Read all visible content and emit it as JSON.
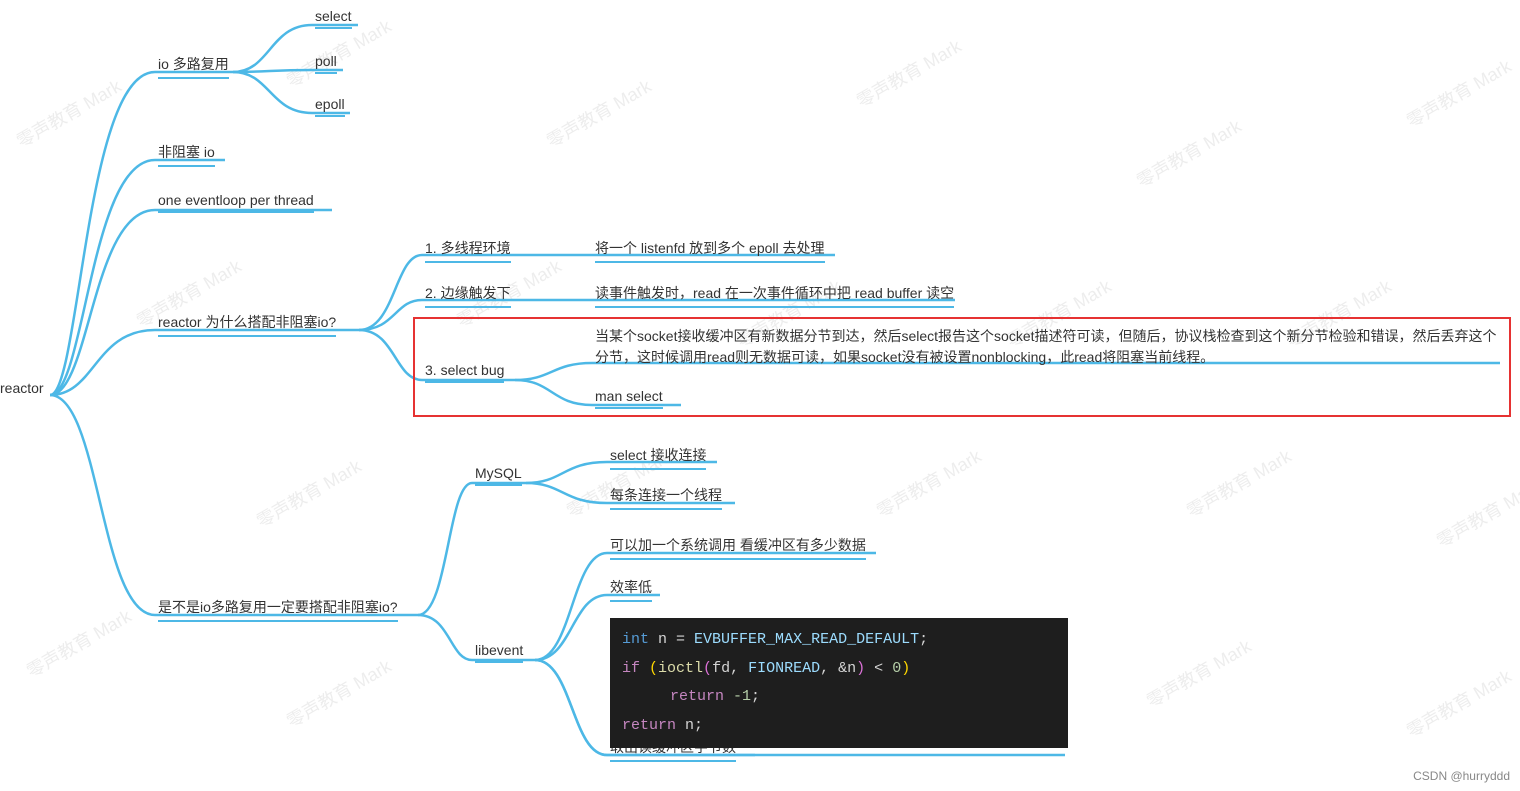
{
  "root": {
    "label": "reactor"
  },
  "branch1": {
    "label": "io 多路复用",
    "children": {
      "c1": "select",
      "c2": "poll",
      "c3": "epoll"
    }
  },
  "branch2": {
    "label": "非阻塞 io"
  },
  "branch3": {
    "label": "one eventloop per thread"
  },
  "branch4": {
    "label": "reactor 为什么搭配非阻塞io?",
    "children": {
      "c1": {
        "label": "1. 多线程环境",
        "leaf": "将一个 listenfd 放到多个 epoll 去处理"
      },
      "c2": {
        "label": "2. 边缘触发下",
        "leaf": "读事件触发时，read 在一次事件循环中把 read buffer 读空"
      },
      "c3": {
        "label": "3. select bug",
        "leaf1": "当某个socket接收缓冲区有新数据分节到达，然后select报告这个socket描述符可读，但随后，协议栈检查到这个新分节检验和错误，然后丢弃这个分节，这时候调用read则无数据可读，如果socket没有被设置nonblocking，此read将阻塞当前线程。",
        "leaf2": "man select"
      }
    }
  },
  "branch5": {
    "label": "是不是io多路复用一定要搭配非阻塞io?",
    "children": {
      "c1": {
        "label": "MySQL",
        "leaf1": "select 接收连接",
        "leaf2": "每条连接一个线程"
      },
      "c2": {
        "label": "libevent",
        "leaf1": "可以加一个系统调用  看缓冲区有多少数据",
        "leaf2": "效率低",
        "leaf3": "取出读缓冲区字节数"
      }
    }
  },
  "code": {
    "line1_a": "int",
    "line1_b": " n ",
    "line1_c": "=",
    "line1_d": " EVBUFFER_MAX_READ_DEFAULT",
    "line1_e": ";",
    "line2_a": "if ",
    "line2_b": "(",
    "line2_c": "ioctl",
    "line2_d": "(",
    "line2_e": "fd",
    "line2_f": ", ",
    "line2_g": "FIONREAD",
    "line2_h": ", ",
    "line2_i": "&",
    "line2_j": "n",
    "line2_k": ")",
    "line2_l": " < ",
    "line2_m": "0",
    "line2_n": ")",
    "line3_a": "return ",
    "line3_b": "-1",
    "line3_c": ";",
    "line4_a": "return ",
    "line4_b": "n",
    "line4_c": ";"
  },
  "watermark_text": "零声教育 Mark",
  "credit": "CSDN @hurryddd"
}
